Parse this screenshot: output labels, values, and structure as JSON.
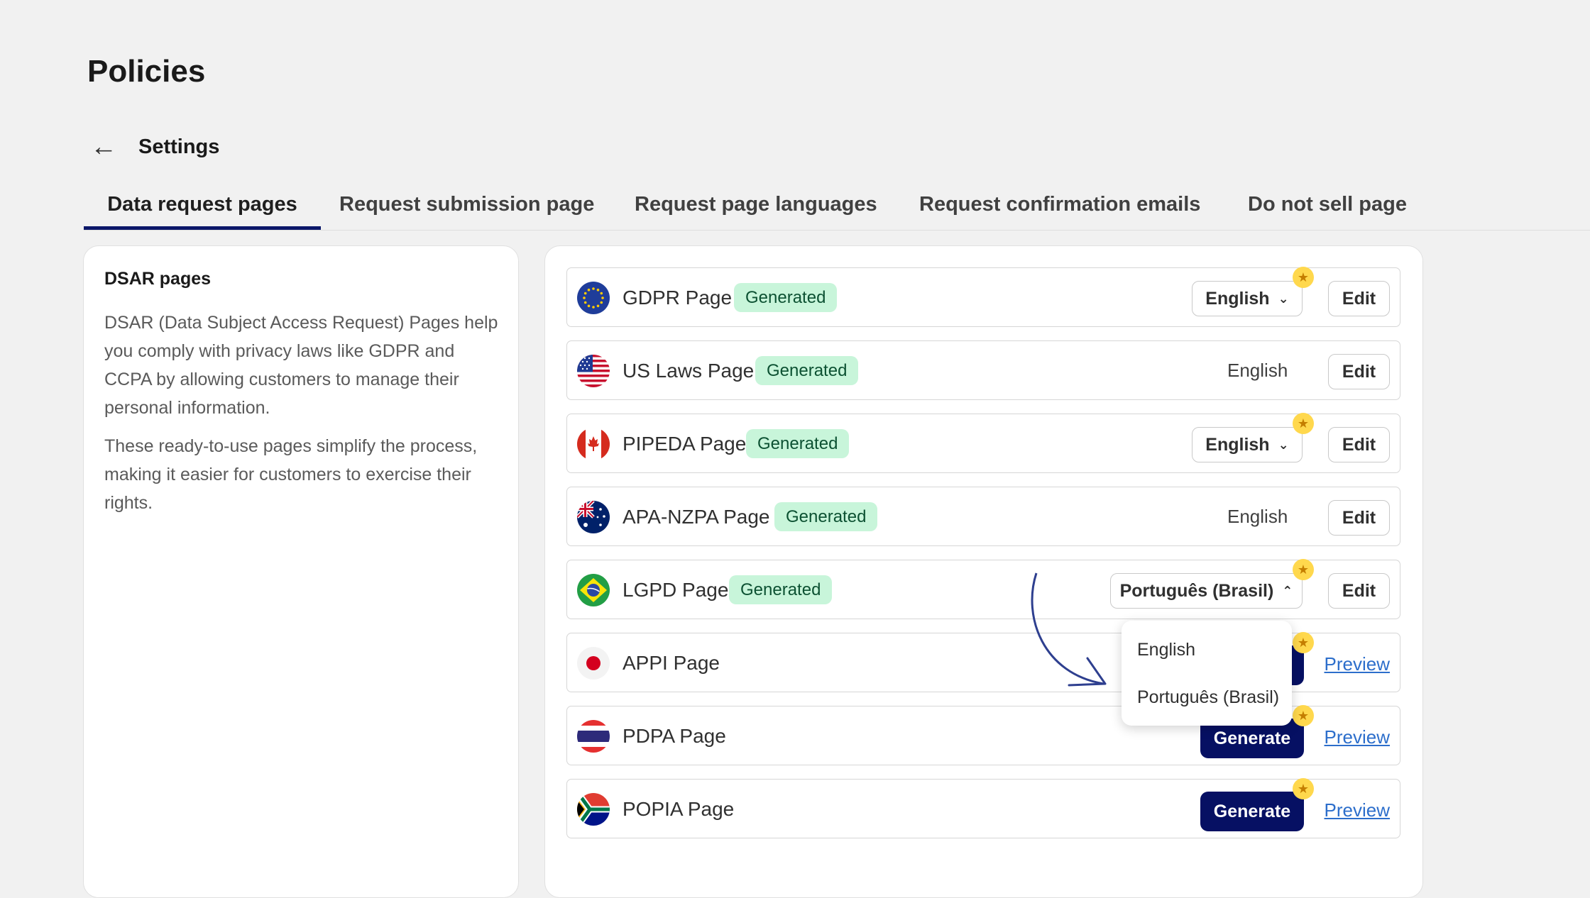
{
  "page": {
    "title": "Policies"
  },
  "header": {
    "back_label": "Settings"
  },
  "tabs": [
    {
      "label": "Data request pages"
    },
    {
      "label": "Request submission page"
    },
    {
      "label": "Request page languages"
    },
    {
      "label": "Request confirmation emails"
    },
    {
      "label": "Do not sell page"
    }
  ],
  "sidebar": {
    "title": "DSAR pages",
    "paragraph1": "DSAR (Data Subject Access Request) Pages help you comply with privacy laws like GDPR and CCPA by allowing customers to manage their personal information.",
    "paragraph2": "These ready-to-use pages simplify the process, making it easier for customers to exercise their rights."
  },
  "rows": [
    {
      "name": "GDPR Page",
      "badge": "Generated",
      "language": "English",
      "action": "Edit",
      "flag": "eu-flag-icon"
    },
    {
      "name": "US Laws Page",
      "badge": "Generated",
      "language": "English",
      "action": "Edit",
      "flag": "us-flag-icon"
    },
    {
      "name": "PIPEDA Page",
      "badge": "Generated",
      "language": "English",
      "action": "Edit",
      "flag": "canada-flag-icon"
    },
    {
      "name": "APA-NZPA Page",
      "badge": "Generated",
      "language": "English",
      "action": "Edit",
      "flag": "australia-flag-icon"
    },
    {
      "name": "LGPD Page",
      "badge": "Generated",
      "language": "Português (Brasil)",
      "action": "Edit",
      "flag": "brazil-flag-icon"
    },
    {
      "name": "APPI Page",
      "action": "Preview",
      "flag": "japan-flag-icon"
    },
    {
      "name": "PDPA Page",
      "generate": "Generate",
      "action": "Preview",
      "flag": "thailand-flag-icon"
    },
    {
      "name": "POPIA Page",
      "generate": "Generate",
      "action": "Preview",
      "flag": "south-africa-flag-icon"
    }
  ],
  "dropdown": {
    "options": [
      "English",
      "Português (Brasil)"
    ]
  },
  "colors": {
    "accent": "#061063",
    "badge_bg": "#c8f5da",
    "badge_text": "#0c5132",
    "link": "#2c6ecb",
    "star": "#ffd84d"
  }
}
